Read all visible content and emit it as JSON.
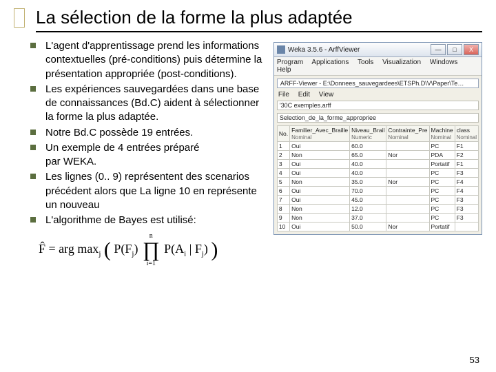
{
  "title": "La sélection de la forme la plus adaptée",
  "bullets": [
    "L'agent d'apprentissage prend les informations contextuelles (pré-conditions) puis détermine la présentation appropriée (post-conditions).",
    "Les expériences sauvegardées dans une base de connaissances (Bd.C) aident à sélectionner la forme  la plus adaptée.",
    "Notre Bd.C possède 19 entrées.",
    "Un exemple de 4 entrées préparé par WEKA.",
    "Les lignes (0.. 9) représentent des scenarios précédent alors que La ligne 10 en représente un nouveau",
    "L'algorithme de Bayes est utilisé:"
  ],
  "formula": {
    "lhs": "F̂ = arg max",
    "sub": "j",
    "open": "(",
    "p1": "P(F",
    "p1sub": "j",
    "p1c": ")",
    "prod": "∏",
    "prod_top": "n",
    "prod_bot": "i=1",
    "p2": "P(A",
    "p2sub": "i",
    "mid": " | F",
    "p2sub2": "j",
    "p2c": ")",
    "close": ")"
  },
  "weka": {
    "title": "Weka 3.5.6 - ArffViewer",
    "win_min": "—",
    "win_max": "□",
    "win_close": "X",
    "menu1": "Program  Applications  Tools  Visualization  Windows  Help",
    "path": "ARFF-Viewer - E:\\Donnees_sauvegardees\\ETSPh.D\\V\\Paper\\Te…",
    "menu2": "File  Edit  View",
    "field": "'30C exemples.arff",
    "tab": "Selection_de_la_forme_appropriee",
    "headers": [
      {
        "h": "No.",
        "s": ""
      },
      {
        "h": "Familier_Avec_Braille",
        "s": "Nominal"
      },
      {
        "h": "Niveau_Brail",
        "s": "Numeric"
      },
      {
        "h": "Contrainte_Pre",
        "s": "Nominal"
      },
      {
        "h": "Machine",
        "s": "Nominal"
      },
      {
        "h": "class",
        "s": "Nominal"
      }
    ],
    "rows": [
      [
        "1",
        "Oui",
        "60.0",
        "",
        "PC",
        "F1"
      ],
      [
        "2",
        "Non",
        "65.0",
        "Nor",
        "PDA",
        "F2"
      ],
      [
        "3",
        "Oui",
        "40.0",
        "",
        "Portatif",
        "F1"
      ],
      [
        "4",
        "Oui",
        "40.0",
        "",
        "PC",
        "F3"
      ],
      [
        "5",
        "Non",
        "35.0",
        "Nor",
        "PC",
        "F4"
      ],
      [
        "6",
        "Oui",
        "70.0",
        "",
        "PC",
        "F4"
      ],
      [
        "7",
        "Oui",
        "45.0",
        "",
        "PC",
        "F3"
      ],
      [
        "8",
        "Non",
        "12.0",
        "",
        "PC",
        "F3"
      ],
      [
        "9",
        "Non",
        "37.0",
        "",
        "PC",
        "F3"
      ],
      [
        "10",
        "Oui",
        "50.0",
        "Nor",
        "Portatif",
        ""
      ]
    ]
  },
  "page_number": "53"
}
